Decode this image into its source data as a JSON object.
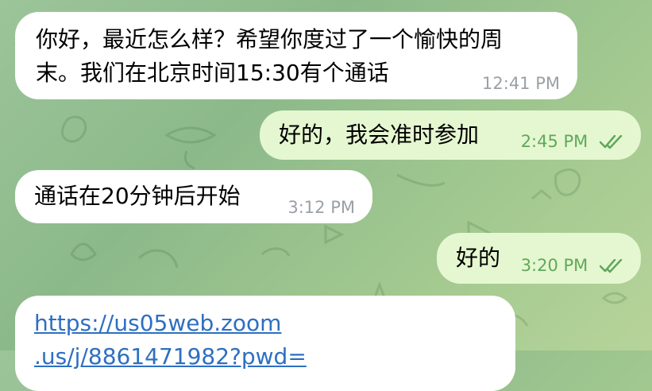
{
  "messages": [
    {
      "direction": "incoming",
      "text_line1": "你好，最近怎么样？希望你度过了一个愉快的周",
      "text_line2": "末。我们在北京时间15:30有个通话",
      "time": "12:41 PM"
    },
    {
      "direction": "outgoing",
      "text": "好的，我会准时参加",
      "time": "2:45 PM",
      "status": "read"
    },
    {
      "direction": "incoming",
      "text": "通话在20分钟后开始",
      "time": "3:12 PM"
    },
    {
      "direction": "outgoing",
      "text": "好的",
      "time": "3:20 PM",
      "status": "read"
    },
    {
      "direction": "incoming",
      "link_line1": "https://us05web.zoom",
      "link_line2": ".us/j/8861471982?pwd="
    }
  ],
  "icons": {
    "read_status": "double-check-icon"
  },
  "colors": {
    "incoming_bubble": "#ffffff",
    "outgoing_bubble": "#e5f7d0",
    "outgoing_meta": "#5fa85c",
    "incoming_meta": "#9aa0a6",
    "link": "#2d6fc2"
  }
}
